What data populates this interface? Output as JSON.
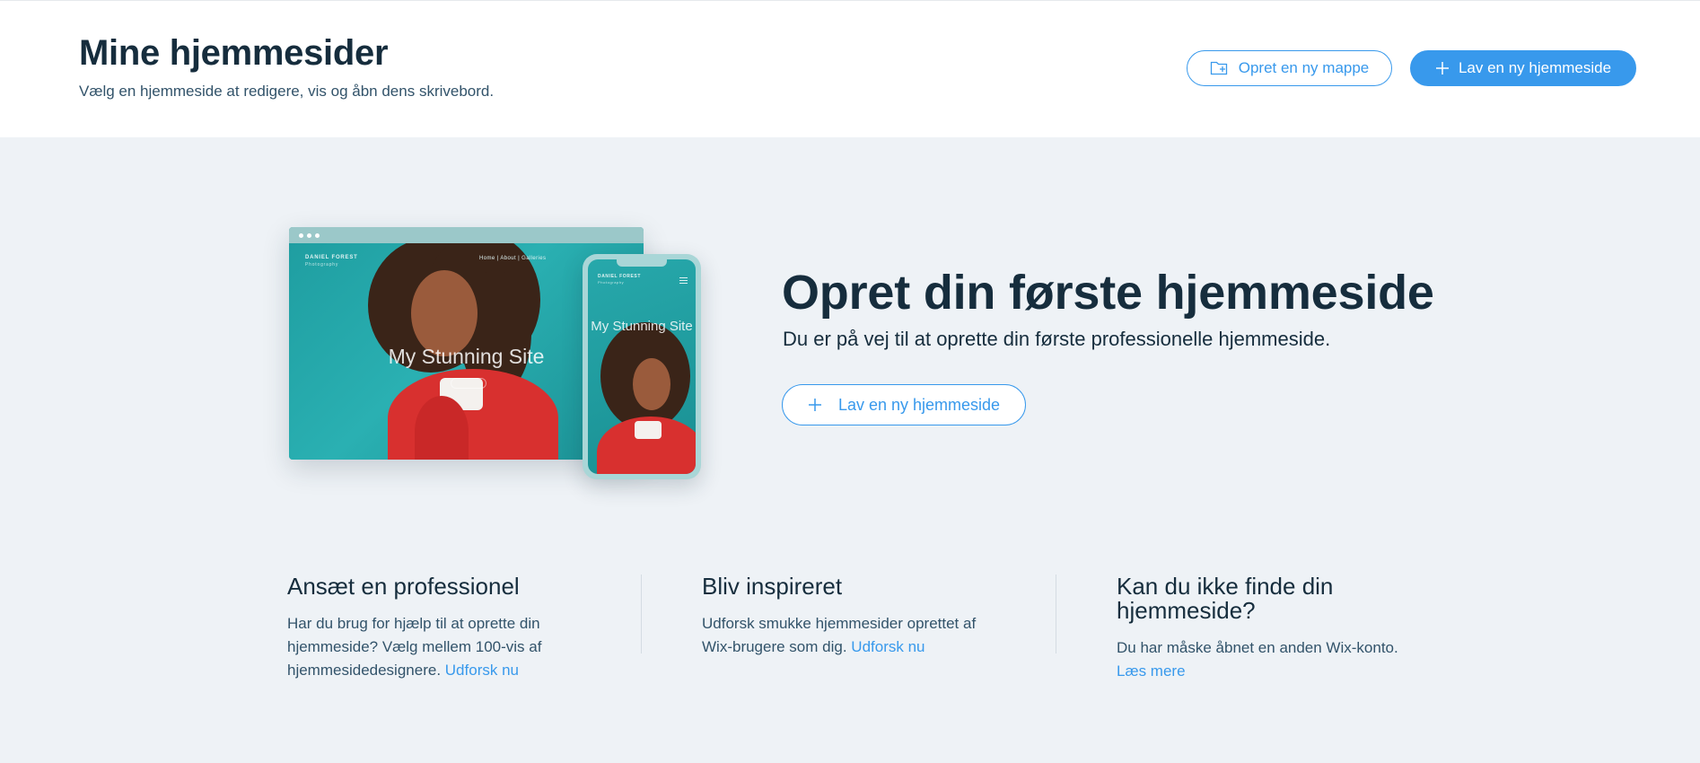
{
  "header": {
    "title": "Mine hjemmesider",
    "subtitle": "Vælg en hjemmeside at redigere, vis og åbn dens skrivebord.",
    "create_folder_label": "Opret en ny mappe",
    "create_site_label": "Lav en ny hjemmeside"
  },
  "preview": {
    "brand_name": "DANIEL FOREST",
    "brand_tagline": "Photography",
    "nav": "Home   |   About   |   Galleries",
    "site_title": "My Stunning Site",
    "phone_title": "My Stunning Site"
  },
  "hero": {
    "title": "Opret din første hjemmeside",
    "subtitle": "Du er på vej til at oprette din første professionelle hjemmeside.",
    "cta_label": "Lav en ny hjemmeside"
  },
  "info": [
    {
      "title": "Ansæt en professionel",
      "text": "Har du brug for hjælp til at oprette din hjemmeside? Vælg mellem 100-vis af hjemmesidedesignere.",
      "link": "Udforsk nu"
    },
    {
      "title": "Bliv inspireret",
      "text": "Udforsk smukke hjemmesider oprettet af Wix-brugere som dig.",
      "link": "Udforsk nu"
    },
    {
      "title": "Kan du ikke finde din hjemmeside?",
      "text": "Du har måske åbnet en anden Wix-konto.",
      "link": "Læs mere"
    }
  ],
  "colors": {
    "accent": "#3899ec",
    "text_dark": "#162d3d",
    "background": "#eef2f6"
  },
  "icons": [
    "folder-plus-icon",
    "plus-icon"
  ]
}
